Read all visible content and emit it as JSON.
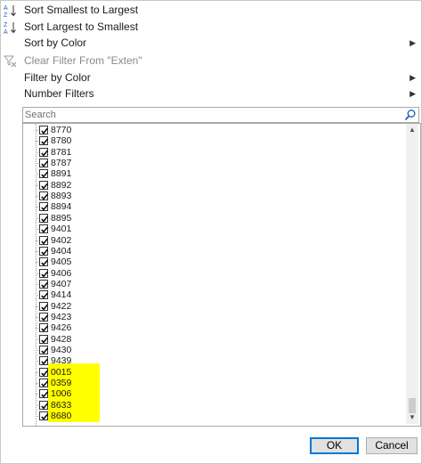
{
  "menu": {
    "sort_asc": "Sort Smallest to Largest",
    "sort_desc": "Sort Largest to Smallest",
    "sort_color": "Sort by Color",
    "clear_filter": "Clear Filter From \"Exten\"",
    "filter_color": "Filter by Color",
    "number_filters": "Number Filters"
  },
  "icons": {
    "sort_asc": "sort-ascending-icon",
    "sort_desc": "sort-descending-icon",
    "clear_filter": "clear-filter-icon",
    "search": "magnifier-icon",
    "submenu": "chevron-right-icon"
  },
  "search": {
    "placeholder": "Search"
  },
  "items": [
    {
      "label": "8770",
      "checked": true
    },
    {
      "label": "8780",
      "checked": true
    },
    {
      "label": "8781",
      "checked": true
    },
    {
      "label": "8787",
      "checked": true
    },
    {
      "label": "8891",
      "checked": true
    },
    {
      "label": "8892",
      "checked": true
    },
    {
      "label": "8893",
      "checked": true
    },
    {
      "label": "8894",
      "checked": true
    },
    {
      "label": "8895",
      "checked": true
    },
    {
      "label": "9401",
      "checked": true
    },
    {
      "label": "9402",
      "checked": true
    },
    {
      "label": "9404",
      "checked": true
    },
    {
      "label": "9405",
      "checked": true
    },
    {
      "label": "9406",
      "checked": true
    },
    {
      "label": "9407",
      "checked": true
    },
    {
      "label": "9414",
      "checked": true
    },
    {
      "label": "9422",
      "checked": true
    },
    {
      "label": "9423",
      "checked": true
    },
    {
      "label": "9426",
      "checked": true
    },
    {
      "label": "9428",
      "checked": true
    },
    {
      "label": "9430",
      "checked": true
    },
    {
      "label": "9439",
      "checked": true
    },
    {
      "label": "0015",
      "checked": true
    },
    {
      "label": "0359",
      "checked": true
    },
    {
      "label": "1006",
      "checked": true
    },
    {
      "label": "8633",
      "checked": true
    },
    {
      "label": "8680",
      "checked": true
    }
  ],
  "highlight_color": "#ffff00",
  "buttons": {
    "ok": "OK",
    "cancel": "Cancel"
  }
}
